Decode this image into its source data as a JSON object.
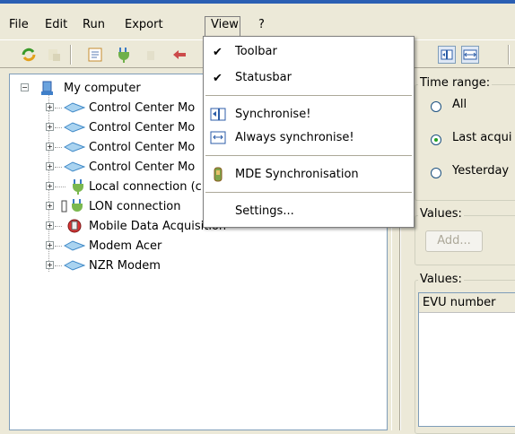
{
  "menubar": {
    "items": [
      "File",
      "Edit",
      "Run",
      "Export",
      "View",
      "?"
    ]
  },
  "view_menu": {
    "items": [
      {
        "label": "Toolbar",
        "checked": true,
        "icon": "check-mark"
      },
      {
        "label": "Statusbar",
        "checked": true,
        "icon": "check-mark"
      },
      {
        "label": "Synchronise!",
        "icon": "synchronise-icon"
      },
      {
        "label": "Always synchronise!",
        "icon": "always-synchronise-icon"
      },
      {
        "label": "MDE Synchronisation",
        "icon": "mde-device-icon"
      },
      {
        "label": "Settings...",
        "icon": ""
      }
    ]
  },
  "tree": {
    "root": {
      "label": "My computer",
      "icon": "computer-icon"
    },
    "items": [
      {
        "label": "Control Center Mo",
        "icon": "network-icon"
      },
      {
        "label": "Control Center Mo",
        "icon": "network-icon"
      },
      {
        "label": "Control Center Mo",
        "icon": "network-icon"
      },
      {
        "label": "Control Center Mo",
        "icon": "network-icon"
      },
      {
        "label": "Local connection (c",
        "icon": "plug-icon"
      },
      {
        "label": "LON connection",
        "icon": "lon-plug-icon"
      },
      {
        "label": "Mobile Data Acquisition",
        "icon": "mobile-device-icon"
      },
      {
        "label": "Modem Acer",
        "icon": "modem-icon"
      },
      {
        "label": "NZR Modem",
        "icon": "modem-icon"
      }
    ]
  },
  "right_panel": {
    "time_range": {
      "label": "Time range:",
      "options": [
        {
          "label": "All",
          "selected": false
        },
        {
          "label": "Last acqui",
          "selected": true
        },
        {
          "label": "Yesterday",
          "selected": false
        }
      ]
    },
    "values_group": {
      "label": "Values:",
      "add_button": "Add..."
    },
    "values_list": {
      "label": "Values:",
      "column": "EVU number"
    }
  },
  "colors": {
    "title_bar": "#2b5fb3",
    "window_bg": "#ece9d8",
    "selection_text": "#000000"
  }
}
